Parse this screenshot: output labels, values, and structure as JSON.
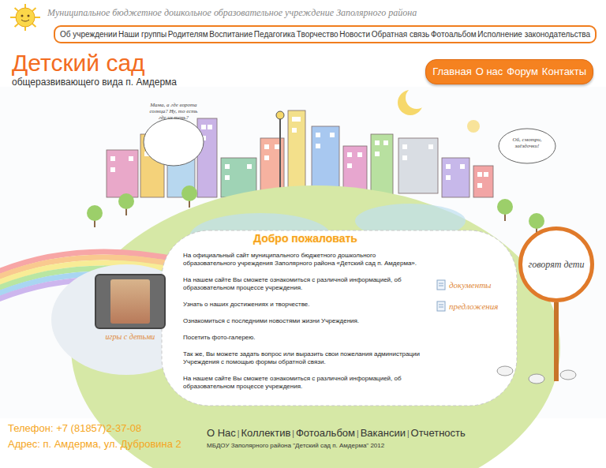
{
  "header": {
    "org_title": "Муниципальное бюджетное дошкольное образовательное учреждение Заполярного района",
    "nav": [
      "Об учреждении",
      "Наши группы",
      "Родителям",
      "Воспитание",
      "Педагогика",
      "Творчество",
      "Новости",
      "Обратная связь",
      "Фотоальбом",
      "Исполнение законодательства"
    ]
  },
  "site": {
    "title": "Детский сад",
    "subtitle": "общеразвивающего вида п. Амдерма"
  },
  "top_menu": [
    "Главная",
    "О нас",
    "Форум",
    "Контакты"
  ],
  "speech_bubbles": [
    "Мама, а где ворота солнца? Ну, то есть где их тень?",
    "Ой, смотри, звёздочки!"
  ],
  "welcome": {
    "heading": "Добро пожаловать",
    "paragraphs": [
      "На официальный сайт муниципального бюджетного дошкольного образовательного учреждения Заполярного района «Детский сад п. Амдерма».",
      "На нашем сайте Вы сможете ознакомиться с различной информацией, об образовательном процессе учреждения.",
      "Узнать о наших достижениях и творчестве.",
      "Ознакомиться с последними новостями жизни Учреждения.",
      "Посетить фото-галерею.",
      "Так же, Вы можете задать вопрос или выразить свои пожелания администрации Учреждения с помощью формы обратной связи.",
      "На нашем сайте Вы сможете ознакомиться с различной информацией, об образовательном процессе учреждения."
    ]
  },
  "games_widget": {
    "label": "игры с детьми"
  },
  "side_links": [
    "документы",
    "предложения"
  ],
  "sign": {
    "label": "говорят дети"
  },
  "contacts": [
    "Телефон: +7 (81857)2-37-08",
    "Адрес: п. Амдерма, ул. Дубровина 2"
  ],
  "footer": {
    "links": [
      "О Нас",
      "Коллектив",
      "Фотоальбом",
      "Вакансии",
      "Отчетность"
    ],
    "separator": "|",
    "copyright": "МБДОУ Заполярного района \"Детский сад п. Амдерма\" 2012"
  }
}
